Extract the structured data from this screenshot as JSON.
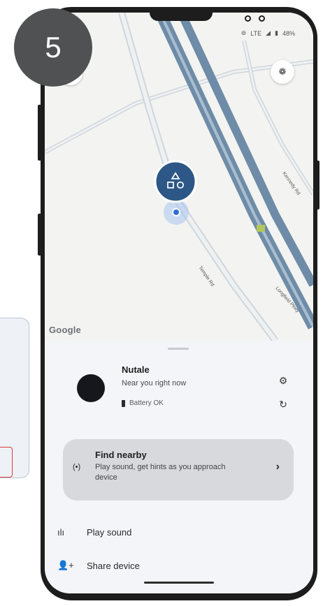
{
  "step": {
    "number": "5"
  },
  "status_bar": {
    "network": "LTE",
    "battery": "48%"
  },
  "map": {
    "road_labels": [
      "Kennedy Rd",
      "Temple Rd",
      "Longfield Pkwy"
    ],
    "attribution": "Google",
    "paw_button_icon": "paw-icon",
    "device_marker_icon": "shapes-icon",
    "location_dot_color": "#2f6fd6",
    "marker_color": "#2c5786"
  },
  "device": {
    "name": "Nutale",
    "proximity": "Near you right now",
    "battery": "Battery OK",
    "settings_icon": "gear-icon",
    "refresh_icon": "refresh-icon"
  },
  "find_nearby": {
    "title": "Find nearby",
    "description": "Play sound, get hints as you approach device",
    "icon": "radar-icon",
    "chevron": "›"
  },
  "actions": [
    {
      "label": "Play sound",
      "icon": "sound-icon"
    },
    {
      "label": "Share device",
      "icon": "add-person-icon"
    }
  ]
}
